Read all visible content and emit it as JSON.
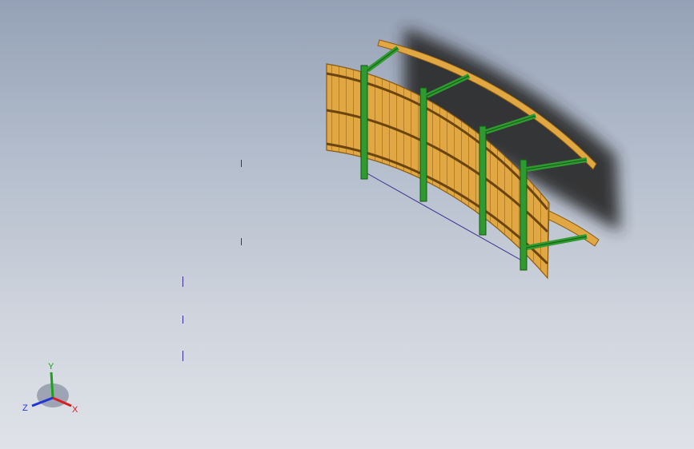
{
  "colors": {
    "wood": "#e0a742",
    "wood_dark": "#8a5a12",
    "frame": "#2f9a2f",
    "frame_dark": "#145a14",
    "shadow": "#2a2a2a",
    "sketch_line": "#3a2f8f",
    "axis_x": "#d62020",
    "axis_y": "#1aa31a",
    "axis_z": "#2035d6"
  },
  "triad": {
    "x_label": "X",
    "y_label": "Y",
    "z_label": "Z"
  },
  "model": {
    "frame_count": 4
  }
}
